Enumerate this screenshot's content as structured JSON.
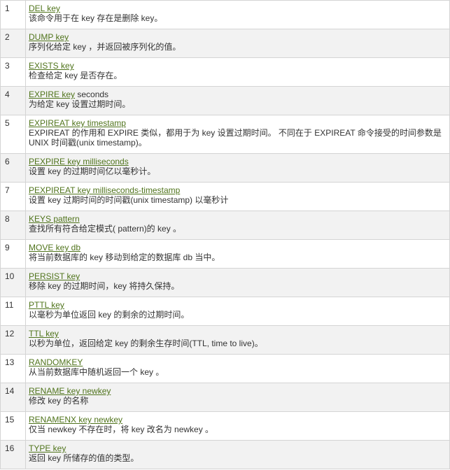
{
  "rows": [
    {
      "num": "1",
      "link": "DEL key",
      "rest": "",
      "desc": "该命令用于在 key 存在是删除 key。"
    },
    {
      "num": "2",
      "link": "DUMP key",
      "rest": "",
      "desc": "序列化给定 key ，并返回被序列化的值。"
    },
    {
      "num": "3",
      "link": "EXISTS key",
      "rest": "",
      "desc": "检查给定 key 是否存在。"
    },
    {
      "num": "4",
      "link": "EXPIRE key",
      "rest": " seconds",
      "desc": "为给定 key 设置过期时间。"
    },
    {
      "num": "5",
      "link": "EXPIREAT key timestamp",
      "rest": "",
      "desc": "EXPIREAT 的作用和 EXPIRE 类似，都用于为 key 设置过期时间。 不同在于 EXPIREAT 命令接受的时间参数是 UNIX 时间戳(unix timestamp)。"
    },
    {
      "num": "6",
      "link": "PEXPIRE key milliseconds",
      "rest": "",
      "desc": "设置 key 的过期时间亿以毫秒计。"
    },
    {
      "num": "7",
      "link": "PEXPIREAT key milliseconds-timestamp",
      "rest": "",
      "desc": "设置 key 过期时间的时间戳(unix timestamp) 以毫秒计"
    },
    {
      "num": "8",
      "link": "KEYS pattern",
      "rest": "",
      "desc": "查找所有符合给定模式( pattern)的 key 。"
    },
    {
      "num": "9",
      "link": "MOVE key db",
      "rest": "",
      "desc": "将当前数据库的 key 移动到给定的数据库 db 当中。"
    },
    {
      "num": "10",
      "link": "PERSIST key",
      "rest": "",
      "desc": "移除 key 的过期时间，key 将持久保持。"
    },
    {
      "num": "11",
      "link": "PTTL key",
      "rest": "",
      "desc": "以毫秒为单位返回 key 的剩余的过期时间。"
    },
    {
      "num": "12",
      "link": "TTL key",
      "rest": "",
      "desc": "以秒为单位，返回给定 key 的剩余生存时间(TTL, time to live)。"
    },
    {
      "num": "13",
      "link": "RANDOMKEY",
      "rest": "",
      "desc": "从当前数据库中随机返回一个 key 。"
    },
    {
      "num": "14",
      "link": "RENAME key newkey",
      "rest": "",
      "desc": "修改 key 的名称"
    },
    {
      "num": "15",
      "link": "RENAMENX key newkey",
      "rest": "",
      "desc": "仅当 newkey 不存在时，将 key 改名为 newkey 。"
    },
    {
      "num": "16",
      "link": "TYPE key",
      "rest": "",
      "desc": "返回 key 所储存的值的类型。"
    }
  ]
}
